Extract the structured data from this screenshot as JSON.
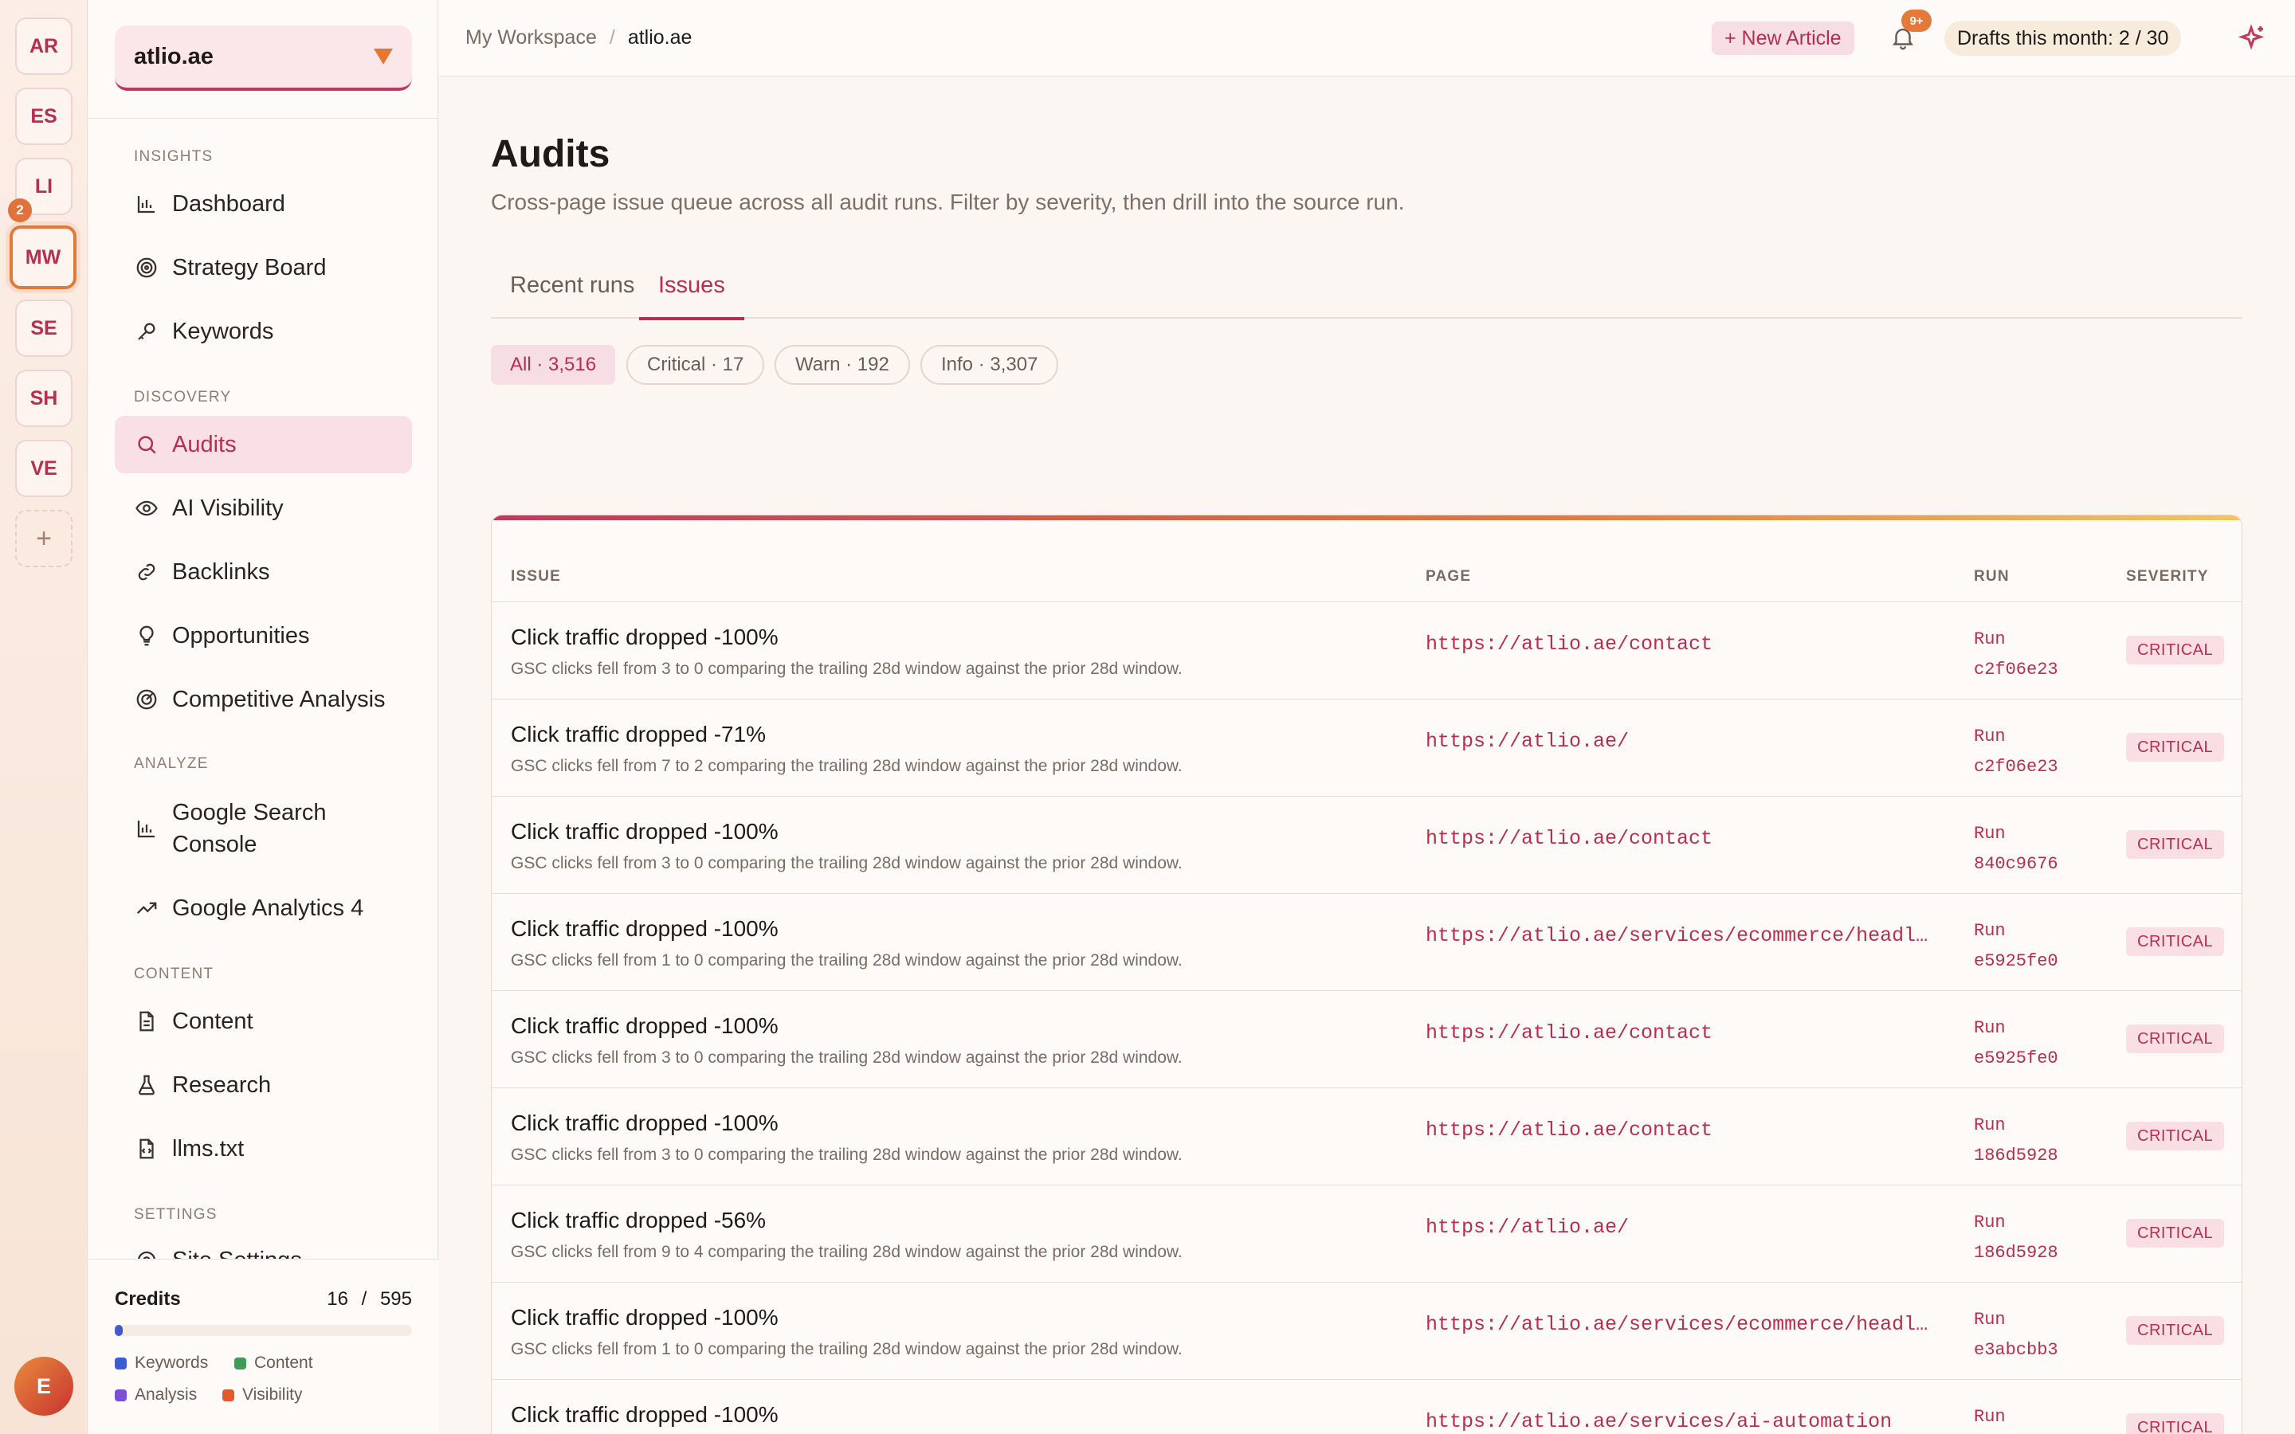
{
  "workspaces": [
    "AR",
    "ES",
    "LI",
    "MW",
    "SE",
    "SH",
    "VE"
  ],
  "workspace_badge": "2",
  "user_initial": "E",
  "site": {
    "name": "atlio.ae"
  },
  "nav": {
    "insights_label": "INSIGHTS",
    "discovery_label": "DISCOVERY",
    "analyze_label": "ANALYZE",
    "content_label": "CONTENT",
    "settings_label": "SETTINGS",
    "dashboard": "Dashboard",
    "strategy": "Strategy Board",
    "keywords": "Keywords",
    "audits": "Audits",
    "ai_visibility": "AI Visibility",
    "backlinks": "Backlinks",
    "opportunities": "Opportunities",
    "competitive": "Competitive Analysis",
    "gsc": "Google Search Console",
    "ga4": "Google Analytics 4",
    "content": "Content",
    "research": "Research",
    "llms": "llms.txt",
    "site_settings": "Site Settings"
  },
  "credits": {
    "title": "Credits",
    "used": "16",
    "sep": "/",
    "total": "595",
    "fraction_used": 0.027,
    "legend": [
      "Keywords",
      "Content",
      "Analysis",
      "Visibility"
    ],
    "colors": [
      "#3f5bd4",
      "#3f9b57",
      "#7b4fd6",
      "#e05a2a"
    ]
  },
  "topbar": {
    "crumb_root": "My Workspace",
    "crumb_sep": "/",
    "crumb_current": "atlio.ae",
    "new_article": "+ New Article",
    "notif_badge": "9+",
    "drafts": "Drafts this month: 2 / 30"
  },
  "page": {
    "title": "Audits",
    "subtitle": "Cross-page issue queue across all audit runs. Filter by severity, then drill into the source run.",
    "tabs": [
      "Recent runs",
      "Issues"
    ],
    "filters": [
      "All · 3,516",
      "Critical · 17",
      "Warn · 192",
      "Info · 3,307"
    ]
  },
  "table": {
    "headers": [
      "ISSUE",
      "PAGE",
      "RUN",
      "SEVERITY"
    ],
    "rows": [
      {
        "title": "Click traffic dropped -100%",
        "desc": "GSC clicks fell from 3 to 0 comparing the trailing 28d window against the prior 28d window.",
        "page": "https://atlio.ae/contact",
        "run_label": "Run",
        "run_id": "c2f06e23",
        "severity": "CRITICAL"
      },
      {
        "title": "Click traffic dropped -71%",
        "desc": "GSC clicks fell from 7 to 2 comparing the trailing 28d window against the prior 28d window.",
        "page": "https://atlio.ae/",
        "run_label": "Run",
        "run_id": "c2f06e23",
        "severity": "CRITICAL"
      },
      {
        "title": "Click traffic dropped -100%",
        "desc": "GSC clicks fell from 3 to 0 comparing the trailing 28d window against the prior 28d window.",
        "page": "https://atlio.ae/contact",
        "run_label": "Run",
        "run_id": "840c9676",
        "severity": "CRITICAL"
      },
      {
        "title": "Click traffic dropped -100%",
        "desc": "GSC clicks fell from 1 to 0 comparing the trailing 28d window against the prior 28d window.",
        "page": "https://atlio.ae/services/ecommerce/headless-commerce",
        "run_label": "Run",
        "run_id": "e5925fe0",
        "severity": "CRITICAL"
      },
      {
        "title": "Click traffic dropped -100%",
        "desc": "GSC clicks fell from 3 to 0 comparing the trailing 28d window against the prior 28d window.",
        "page": "https://atlio.ae/contact",
        "run_label": "Run",
        "run_id": "e5925fe0",
        "severity": "CRITICAL"
      },
      {
        "title": "Click traffic dropped -100%",
        "desc": "GSC clicks fell from 3 to 0 comparing the trailing 28d window against the prior 28d window.",
        "page": "https://atlio.ae/contact",
        "run_label": "Run",
        "run_id": "186d5928",
        "severity": "CRITICAL"
      },
      {
        "title": "Click traffic dropped -56%",
        "desc": "GSC clicks fell from 9 to 4 comparing the trailing 28d window against the prior 28d window.",
        "page": "https://atlio.ae/",
        "run_label": "Run",
        "run_id": "186d5928",
        "severity": "CRITICAL"
      },
      {
        "title": "Click traffic dropped -100%",
        "desc": "GSC clicks fell from 1 to 0 comparing the trailing 28d window against the prior 28d window.",
        "page": "https://atlio.ae/services/ecommerce/headless-commerce",
        "run_label": "Run",
        "run_id": "e3abcbb3",
        "severity": "CRITICAL"
      },
      {
        "title": "Click traffic dropped -100%",
        "desc": "",
        "page": "https://atlio.ae/services/ai-automation",
        "run_label": "Run",
        "run_id": "",
        "severity": "CRITICAL"
      }
    ]
  },
  "colors": {
    "accent": "#b5304f",
    "orange": "#e27834",
    "bg": "#fbf6f1"
  }
}
